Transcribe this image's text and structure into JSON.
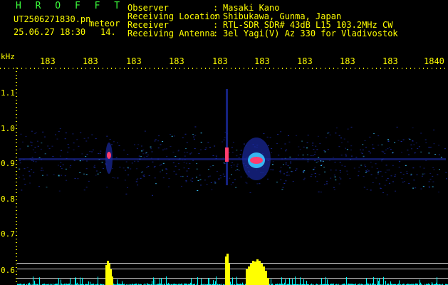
{
  "header": {
    "brand": "H R O F F T",
    "file": "UT2506271830.pn",
    "meteor": "meteor",
    "datetime": "25.06.27 18:30",
    "count": "14."
  },
  "info": [
    {
      "label": "Observer",
      "value": "Masaki Kano"
    },
    {
      "label": "Receiving Location",
      "value": "Shibukawa, Gunma, Japan"
    },
    {
      "label": "Receiver",
      "value": "RTL-SDR SDR# 43dB L15 103.2MHz CW"
    },
    {
      "label": "Receiving Antenna",
      "value": "3el Yagi(V) Az 330 for Vladivostok"
    }
  ],
  "axis": {
    "unit": "kHz",
    "x_ticks": [
      "183",
      "183",
      "183",
      "183",
      "183",
      "183",
      "183",
      "183",
      "183",
      "1840"
    ],
    "y_ticks": [
      "1.1",
      "1.0",
      "0.9",
      "0.8",
      "0.7",
      "0.6"
    ]
  },
  "colors": {
    "background": "#000000",
    "text": "#ffff00",
    "brand": "#3cff3c",
    "noise": "#1a2aa0",
    "echo_core": "#ff3c6e",
    "echo_mid": "#3cc8ff",
    "histogram": "#ffff00",
    "baseline": "#00ffff",
    "refline": "#c8c8c8"
  }
}
